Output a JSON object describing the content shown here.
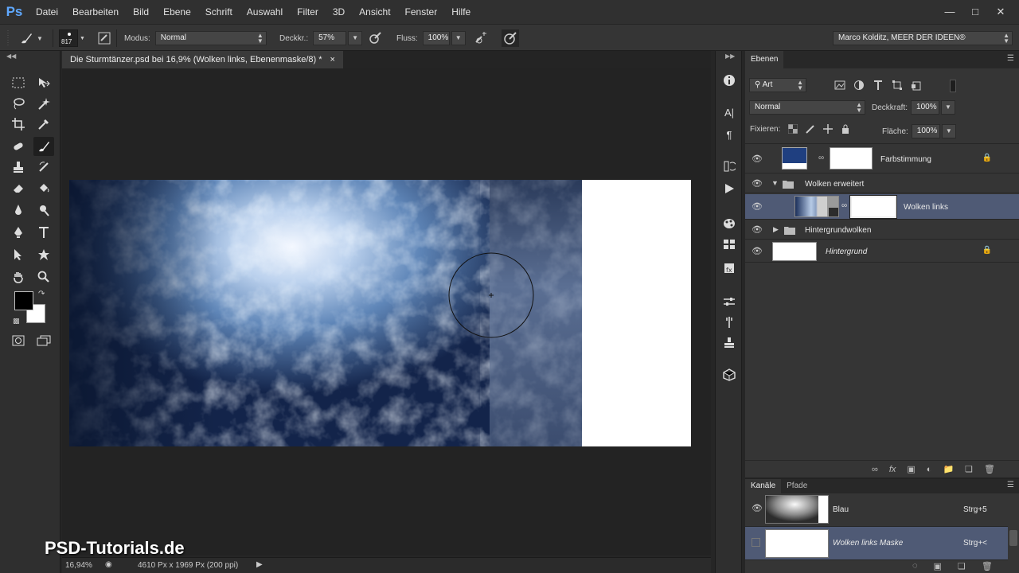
{
  "app": {
    "logo": "Ps"
  },
  "menu": [
    "Datei",
    "Bearbeiten",
    "Bild",
    "Ebene",
    "Schrift",
    "Auswahl",
    "Filter",
    "3D",
    "Ansicht",
    "Fenster",
    "Hilfe"
  ],
  "window_controls": [
    "minimize",
    "restore",
    "close"
  ],
  "options_bar": {
    "brush_size": "817",
    "mode_label": "Modus:",
    "mode_value": "Normal",
    "opacity_label": "Deckkr.:",
    "opacity_value": "57%",
    "flow_label": "Fluss:",
    "flow_value": "100%",
    "workspace": "Marco Kolditz, MEER DER IDEEN®"
  },
  "document": {
    "tab_title": "Die Sturmtänzer.psd bei 16,9% (Wolken links, Ebenenmaske/8) *",
    "close_glyph": "×",
    "zoom": "16,94%",
    "doc_info": "4610 Px x 1969 Px (200 ppi)"
  },
  "layers_panel": {
    "tab": "Ebenen",
    "filter_kind": "Art",
    "blend_mode": "Normal",
    "opacity_label": "Deckkraft:",
    "opacity_value": "100%",
    "lock_label": "Fixieren:",
    "fill_label": "Fläche:",
    "fill_value": "100%",
    "layers": [
      {
        "name": "Farbstimmung",
        "visible": true,
        "locked": true,
        "type": "fill"
      },
      {
        "name": "Wolken erweitert",
        "visible": true,
        "type": "group",
        "expanded": true
      },
      {
        "name": "Wolken links",
        "visible": true,
        "type": "pixel",
        "selected": true
      },
      {
        "name": "Hintergrundwolken",
        "visible": true,
        "type": "group",
        "expanded": false
      },
      {
        "name": "Hintergrund",
        "visible": true,
        "locked": true,
        "type": "background"
      }
    ]
  },
  "channels_panel": {
    "tabs": [
      "Kanäle",
      "Pfade"
    ],
    "channels": [
      {
        "name": "Blau",
        "shortcut": "Strg+5",
        "visible": true
      },
      {
        "name": "Wolken links Maske",
        "shortcut": "Strg+<",
        "visible": false,
        "selected": true
      }
    ]
  },
  "watermark": "PSD-Tutorials.de",
  "colors": {
    "foreground": "#000000",
    "background": "#ffffff",
    "fill_swatch": "#1f3f80",
    "selection": "#4f5a75"
  }
}
